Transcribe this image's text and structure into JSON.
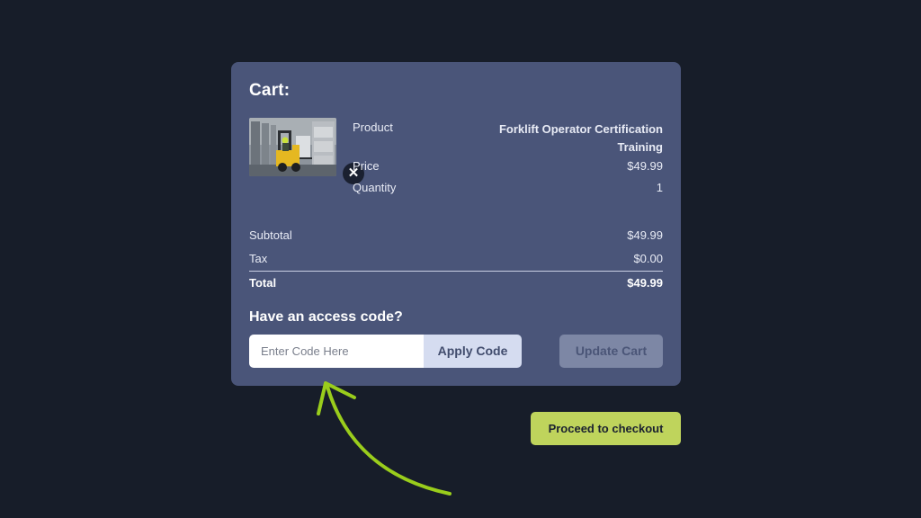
{
  "cart": {
    "title": "Cart:",
    "remove_icon": "close-icon",
    "product_image": "forklift-warehouse-photo",
    "rows": {
      "product_label": "Product",
      "product_value": "Forklift Operator Certification Training",
      "price_label": "Price",
      "price_value": "$49.99",
      "quantity_label": "Quantity",
      "quantity_value": "1"
    },
    "summary": {
      "subtotal_label": "Subtotal",
      "subtotal_value": "$49.99",
      "tax_label": "Tax",
      "tax_value": "$0.00",
      "total_label": "Total",
      "total_value": "$49.99"
    },
    "access": {
      "title": "Have an access code?",
      "placeholder": "Enter Code Here",
      "apply_label": "Apply Code",
      "update_label": "Update Cart"
    }
  },
  "checkout": {
    "label": "Proceed to checkout"
  },
  "annotation": {
    "arrow_icon": "curved-arrow-icon",
    "arrow_color": "#9acd1c"
  },
  "colors": {
    "background": "#171d29",
    "panel": "#4a5579",
    "accent_green": "#bfd45c"
  }
}
